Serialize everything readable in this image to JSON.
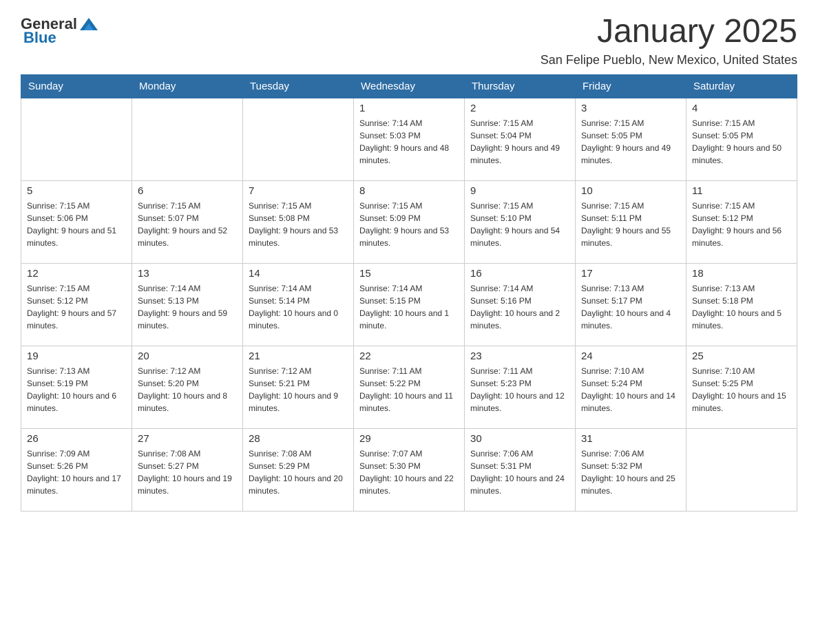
{
  "header": {
    "logo_general": "General",
    "logo_blue": "Blue",
    "month_title": "January 2025",
    "location": "San Felipe Pueblo, New Mexico, United States"
  },
  "days_of_week": [
    "Sunday",
    "Monday",
    "Tuesday",
    "Wednesday",
    "Thursday",
    "Friday",
    "Saturday"
  ],
  "weeks": [
    [
      {
        "day": "",
        "sunrise": "",
        "sunset": "",
        "daylight": ""
      },
      {
        "day": "",
        "sunrise": "",
        "sunset": "",
        "daylight": ""
      },
      {
        "day": "",
        "sunrise": "",
        "sunset": "",
        "daylight": ""
      },
      {
        "day": "1",
        "sunrise": "Sunrise: 7:14 AM",
        "sunset": "Sunset: 5:03 PM",
        "daylight": "Daylight: 9 hours and 48 minutes."
      },
      {
        "day": "2",
        "sunrise": "Sunrise: 7:15 AM",
        "sunset": "Sunset: 5:04 PM",
        "daylight": "Daylight: 9 hours and 49 minutes."
      },
      {
        "day": "3",
        "sunrise": "Sunrise: 7:15 AM",
        "sunset": "Sunset: 5:05 PM",
        "daylight": "Daylight: 9 hours and 49 minutes."
      },
      {
        "day": "4",
        "sunrise": "Sunrise: 7:15 AM",
        "sunset": "Sunset: 5:05 PM",
        "daylight": "Daylight: 9 hours and 50 minutes."
      }
    ],
    [
      {
        "day": "5",
        "sunrise": "Sunrise: 7:15 AM",
        "sunset": "Sunset: 5:06 PM",
        "daylight": "Daylight: 9 hours and 51 minutes."
      },
      {
        "day": "6",
        "sunrise": "Sunrise: 7:15 AM",
        "sunset": "Sunset: 5:07 PM",
        "daylight": "Daylight: 9 hours and 52 minutes."
      },
      {
        "day": "7",
        "sunrise": "Sunrise: 7:15 AM",
        "sunset": "Sunset: 5:08 PM",
        "daylight": "Daylight: 9 hours and 53 minutes."
      },
      {
        "day": "8",
        "sunrise": "Sunrise: 7:15 AM",
        "sunset": "Sunset: 5:09 PM",
        "daylight": "Daylight: 9 hours and 53 minutes."
      },
      {
        "day": "9",
        "sunrise": "Sunrise: 7:15 AM",
        "sunset": "Sunset: 5:10 PM",
        "daylight": "Daylight: 9 hours and 54 minutes."
      },
      {
        "day": "10",
        "sunrise": "Sunrise: 7:15 AM",
        "sunset": "Sunset: 5:11 PM",
        "daylight": "Daylight: 9 hours and 55 minutes."
      },
      {
        "day": "11",
        "sunrise": "Sunrise: 7:15 AM",
        "sunset": "Sunset: 5:12 PM",
        "daylight": "Daylight: 9 hours and 56 minutes."
      }
    ],
    [
      {
        "day": "12",
        "sunrise": "Sunrise: 7:15 AM",
        "sunset": "Sunset: 5:12 PM",
        "daylight": "Daylight: 9 hours and 57 minutes."
      },
      {
        "day": "13",
        "sunrise": "Sunrise: 7:14 AM",
        "sunset": "Sunset: 5:13 PM",
        "daylight": "Daylight: 9 hours and 59 minutes."
      },
      {
        "day": "14",
        "sunrise": "Sunrise: 7:14 AM",
        "sunset": "Sunset: 5:14 PM",
        "daylight": "Daylight: 10 hours and 0 minutes."
      },
      {
        "day": "15",
        "sunrise": "Sunrise: 7:14 AM",
        "sunset": "Sunset: 5:15 PM",
        "daylight": "Daylight: 10 hours and 1 minute."
      },
      {
        "day": "16",
        "sunrise": "Sunrise: 7:14 AM",
        "sunset": "Sunset: 5:16 PM",
        "daylight": "Daylight: 10 hours and 2 minutes."
      },
      {
        "day": "17",
        "sunrise": "Sunrise: 7:13 AM",
        "sunset": "Sunset: 5:17 PM",
        "daylight": "Daylight: 10 hours and 4 minutes."
      },
      {
        "day": "18",
        "sunrise": "Sunrise: 7:13 AM",
        "sunset": "Sunset: 5:18 PM",
        "daylight": "Daylight: 10 hours and 5 minutes."
      }
    ],
    [
      {
        "day": "19",
        "sunrise": "Sunrise: 7:13 AM",
        "sunset": "Sunset: 5:19 PM",
        "daylight": "Daylight: 10 hours and 6 minutes."
      },
      {
        "day": "20",
        "sunrise": "Sunrise: 7:12 AM",
        "sunset": "Sunset: 5:20 PM",
        "daylight": "Daylight: 10 hours and 8 minutes."
      },
      {
        "day": "21",
        "sunrise": "Sunrise: 7:12 AM",
        "sunset": "Sunset: 5:21 PM",
        "daylight": "Daylight: 10 hours and 9 minutes."
      },
      {
        "day": "22",
        "sunrise": "Sunrise: 7:11 AM",
        "sunset": "Sunset: 5:22 PM",
        "daylight": "Daylight: 10 hours and 11 minutes."
      },
      {
        "day": "23",
        "sunrise": "Sunrise: 7:11 AM",
        "sunset": "Sunset: 5:23 PM",
        "daylight": "Daylight: 10 hours and 12 minutes."
      },
      {
        "day": "24",
        "sunrise": "Sunrise: 7:10 AM",
        "sunset": "Sunset: 5:24 PM",
        "daylight": "Daylight: 10 hours and 14 minutes."
      },
      {
        "day": "25",
        "sunrise": "Sunrise: 7:10 AM",
        "sunset": "Sunset: 5:25 PM",
        "daylight": "Daylight: 10 hours and 15 minutes."
      }
    ],
    [
      {
        "day": "26",
        "sunrise": "Sunrise: 7:09 AM",
        "sunset": "Sunset: 5:26 PM",
        "daylight": "Daylight: 10 hours and 17 minutes."
      },
      {
        "day": "27",
        "sunrise": "Sunrise: 7:08 AM",
        "sunset": "Sunset: 5:27 PM",
        "daylight": "Daylight: 10 hours and 19 minutes."
      },
      {
        "day": "28",
        "sunrise": "Sunrise: 7:08 AM",
        "sunset": "Sunset: 5:29 PM",
        "daylight": "Daylight: 10 hours and 20 minutes."
      },
      {
        "day": "29",
        "sunrise": "Sunrise: 7:07 AM",
        "sunset": "Sunset: 5:30 PM",
        "daylight": "Daylight: 10 hours and 22 minutes."
      },
      {
        "day": "30",
        "sunrise": "Sunrise: 7:06 AM",
        "sunset": "Sunset: 5:31 PM",
        "daylight": "Daylight: 10 hours and 24 minutes."
      },
      {
        "day": "31",
        "sunrise": "Sunrise: 7:06 AM",
        "sunset": "Sunset: 5:32 PM",
        "daylight": "Daylight: 10 hours and 25 minutes."
      },
      {
        "day": "",
        "sunrise": "",
        "sunset": "",
        "daylight": ""
      }
    ]
  ]
}
